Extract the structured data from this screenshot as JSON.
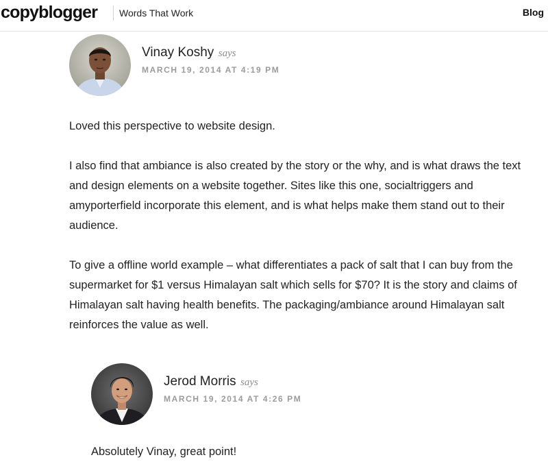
{
  "header": {
    "logo_text": "copyblogger",
    "tagline": "Words That Work",
    "nav_blog": "Blog"
  },
  "comments": [
    {
      "author": "Vinay Koshy",
      "says": "says",
      "date": "MARCH 19, 2014 AT 4:19 PM",
      "paragraphs": [
        "Loved this perspective to website design.",
        "I also find that ambiance is also created by the story or the why, and is what draws the text and design elements on a website together. Sites like this one, socialtriggers and amyporterfield incorporate this element, and is what helps make them stand out to their audience.",
        "To give a offline world example – what differentiates a pack of salt that I can buy from the supermarket for $1 versus Himalayan salt which sells for $70? It is the story and claims of Himalayan salt having health benefits. The packaging/ambiance around Himalayan salt reinforces the value as well."
      ]
    },
    {
      "author": "Jerod Morris",
      "says": "says",
      "date": "MARCH 19, 2014 AT 4:26 PM",
      "paragraphs": [
        "Absolutely Vinay, great point!"
      ]
    }
  ],
  "colors": {
    "text": "#222222",
    "muted": "#9b9b9b",
    "divider": "#e6e6e6"
  }
}
